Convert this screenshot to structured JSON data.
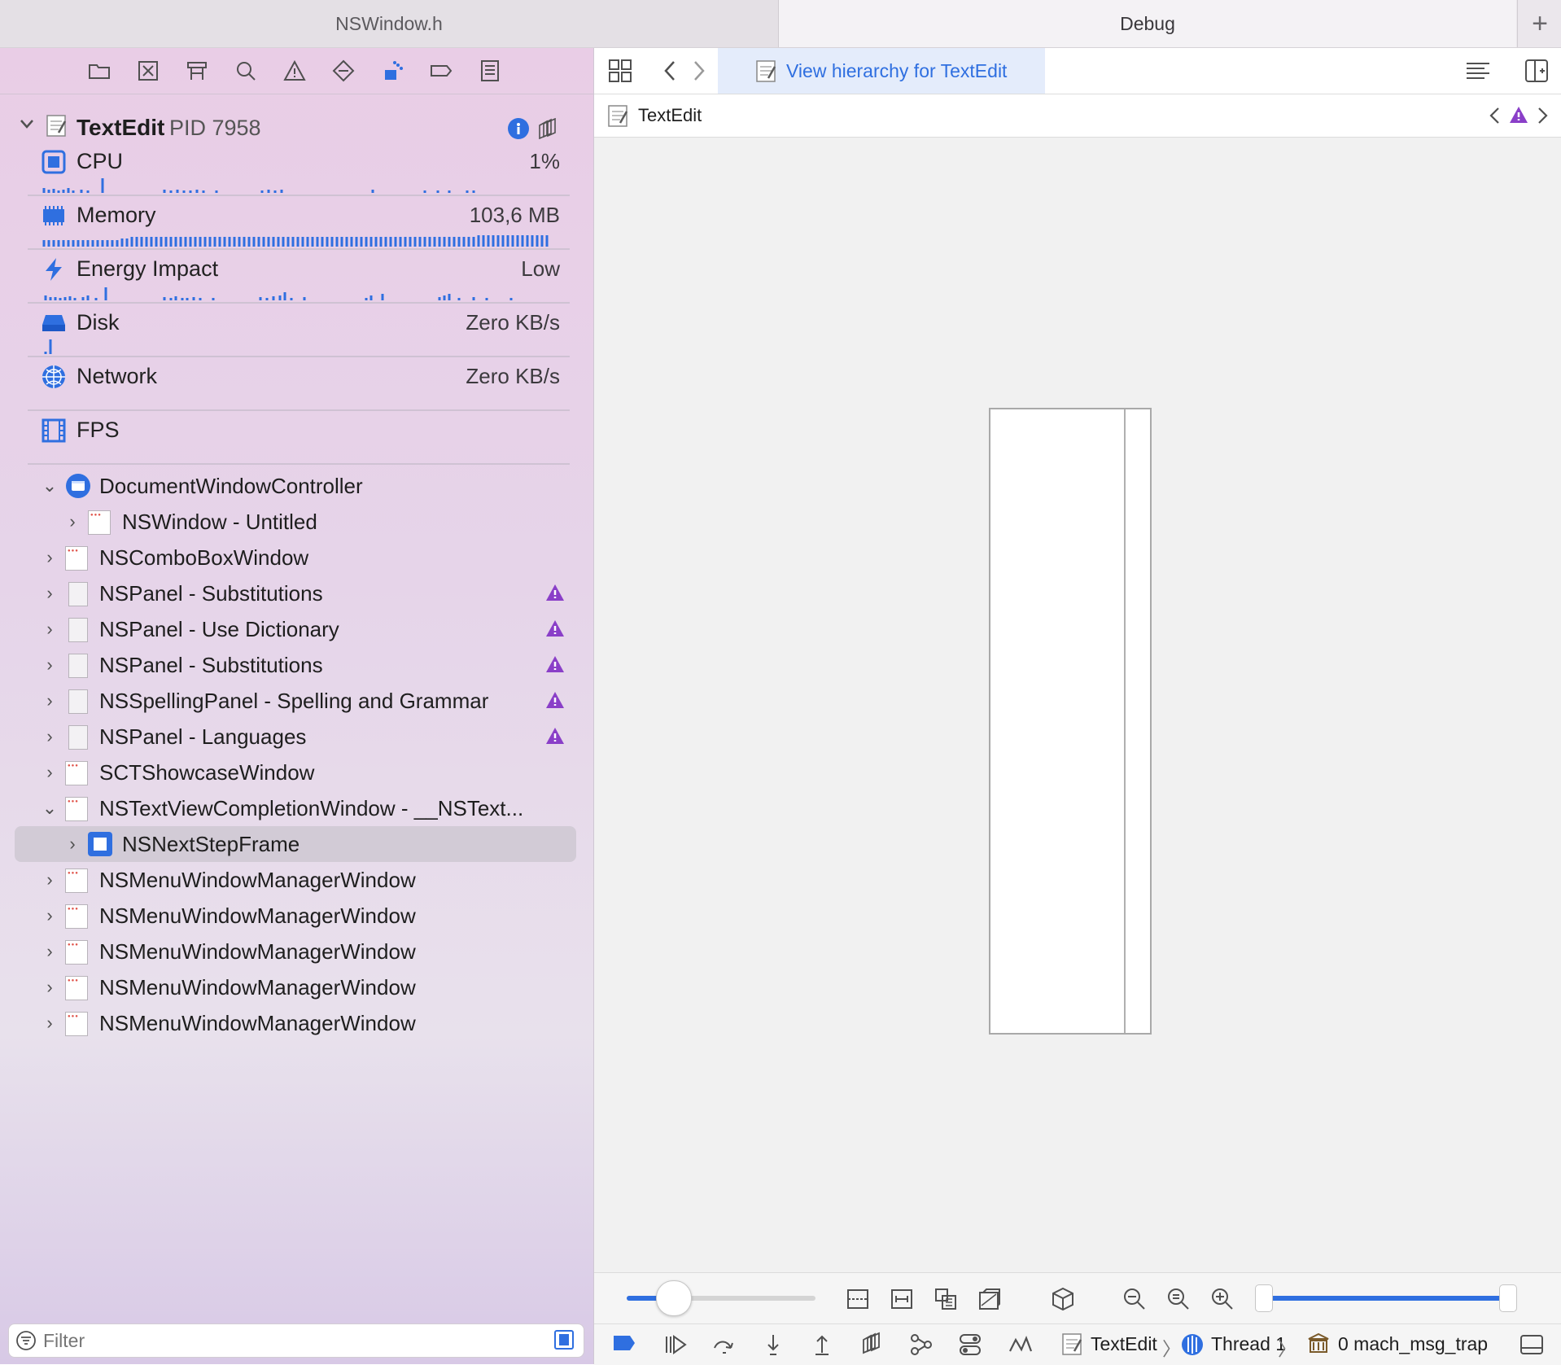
{
  "tabs": [
    {
      "label": "NSWindow.h"
    },
    {
      "label": "Debug"
    }
  ],
  "add_tab_glyph": "+",
  "navigator": {
    "icons": [
      "folder-icon",
      "source-control-icon",
      "symbol-icon",
      "find-icon",
      "issue-icon",
      "test-icon",
      "debug-icon",
      "breakpoint-icon",
      "report-icon"
    ]
  },
  "process": {
    "name": "TextEdit",
    "pid_label": "PID 7958"
  },
  "gauges": [
    {
      "label": "CPU",
      "value": "1%",
      "icon": "cpu-icon"
    },
    {
      "label": "Memory",
      "value": "103,6 MB",
      "icon": "memory-icon"
    },
    {
      "label": "Energy Impact",
      "value": "Low",
      "icon": "bolt-icon"
    },
    {
      "label": "Disk",
      "value": "Zero KB/s",
      "icon": "disk-icon"
    },
    {
      "label": "Network",
      "value": "Zero KB/s",
      "icon": "globe-icon"
    },
    {
      "label": "FPS",
      "value": "",
      "icon": "film-icon"
    }
  ],
  "tree": [
    {
      "label": "DocumentWindowController",
      "expanded": true,
      "warn": false
    },
    {
      "label": "NSWindow - Untitled",
      "expanded": false,
      "warn": false
    },
    {
      "label": "NSComboBoxWindow",
      "expanded": false,
      "warn": false
    },
    {
      "label": "NSPanel - Substitutions",
      "expanded": false,
      "warn": true
    },
    {
      "label": "NSPanel - Use Dictionary",
      "expanded": false,
      "warn": true
    },
    {
      "label": "NSPanel - Substitutions",
      "expanded": false,
      "warn": true
    },
    {
      "label": "NSSpellingPanel - Spelling and Grammar",
      "expanded": false,
      "warn": true
    },
    {
      "label": "NSPanel - Languages",
      "expanded": false,
      "warn": true
    },
    {
      "label": "SCTShowcaseWindow",
      "expanded": false,
      "warn": false
    },
    {
      "label": "NSTextViewCompletionWindow - __NSText...",
      "expanded": true,
      "warn": false
    },
    {
      "label": "NSNextStepFrame",
      "expanded": false,
      "warn": false,
      "selected": true
    },
    {
      "label": "NSMenuWindowManagerWindow",
      "expanded": false,
      "warn": false
    },
    {
      "label": "NSMenuWindowManagerWindow",
      "expanded": false,
      "warn": false
    },
    {
      "label": "NSMenuWindowManagerWindow",
      "expanded": false,
      "warn": false
    },
    {
      "label": "NSMenuWindowManagerWindow",
      "expanded": false,
      "warn": false
    },
    {
      "label": "NSMenuWindowManagerWindow",
      "expanded": false,
      "warn": false
    }
  ],
  "filter": {
    "placeholder": "Filter"
  },
  "editor": {
    "tab_title": "View hierarchy for TextEdit",
    "jump_label": "TextEdit"
  },
  "debug_bar": {
    "process": "TextEdit",
    "thread": "Thread 1",
    "frame": "0 mach_msg_trap"
  },
  "colors": {
    "accent": "#2f6fe0",
    "warning_purple": "#8a3fc8"
  }
}
